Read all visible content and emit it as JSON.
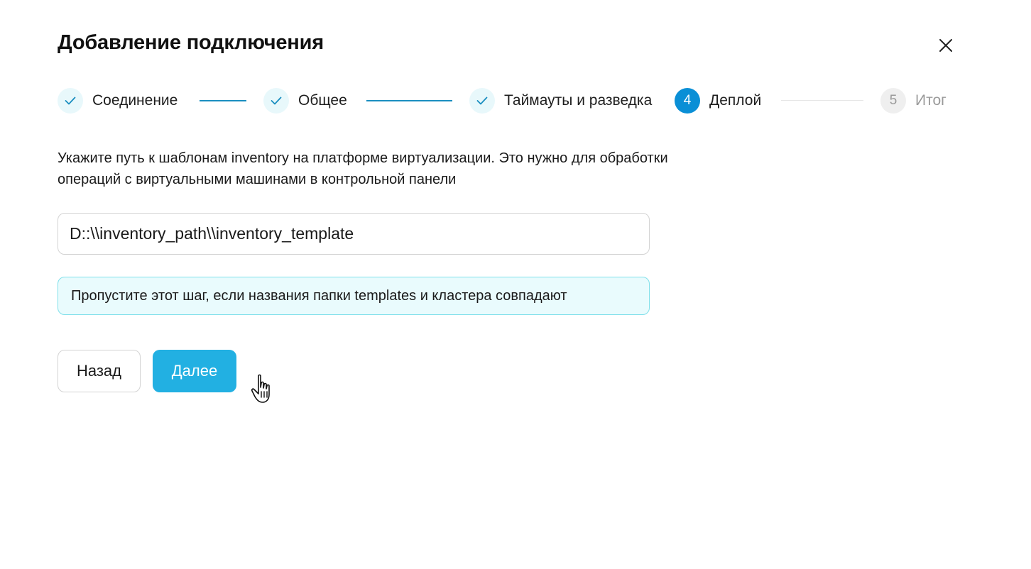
{
  "dialog": {
    "title": "Добавление подключения"
  },
  "stepper": {
    "steps": [
      {
        "label": "Соединение",
        "status": "done",
        "number": "1"
      },
      {
        "label": "Общее",
        "status": "done",
        "number": "2"
      },
      {
        "label": "Таймауты и разведка",
        "status": "done",
        "number": "3"
      },
      {
        "label": "Деплой",
        "status": "active",
        "number": "4"
      },
      {
        "label": "Итог",
        "status": "pending",
        "number": "5"
      }
    ]
  },
  "content": {
    "description": "Укажите путь к шаблонам inventory на платформе виртуализации. Это нужно для обработки операций с виртуальными машинами в контрольной панели",
    "path_value": "D::\\\\inventory_path\\\\inventory_template",
    "info_text": "Пропустите этот шаг, если названия папки templates и кластера совпадают"
  },
  "actions": {
    "back_label": "Назад",
    "next_label": "Далее"
  },
  "colors": {
    "accent": "#22b0e2",
    "active_step": "#0a8fd6",
    "done_step_bg": "#e8f8fb",
    "info_bg": "#e9fbfd",
    "info_border": "#7fe0ea"
  },
  "icons": {
    "close": "close-icon",
    "done_step": "check-icon",
    "cursor": "hand-pointer-icon"
  }
}
